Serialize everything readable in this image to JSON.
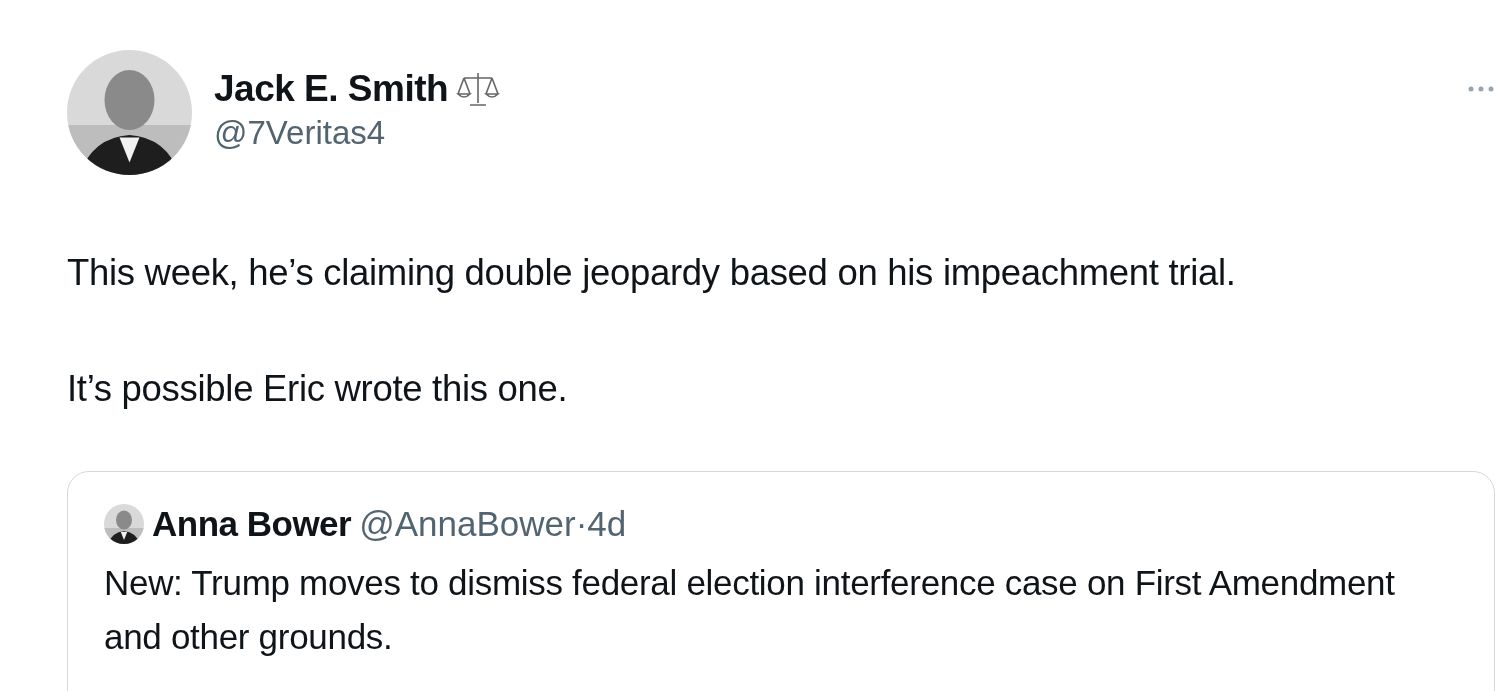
{
  "author": {
    "name": "Jack E. Smith",
    "handle": "@7Veritas4"
  },
  "paragraphs": [
    "This week, he’s claiming double jeopardy based on his impeachment trial.",
    "It’s possible Eric wrote this one."
  ],
  "quote": {
    "name": "Anna Bower",
    "handle": "@AnnaBower",
    "separator": "·",
    "time": "4d",
    "text": "New: Trump moves to dismiss federal election interference case on First Amendment and other grounds."
  }
}
